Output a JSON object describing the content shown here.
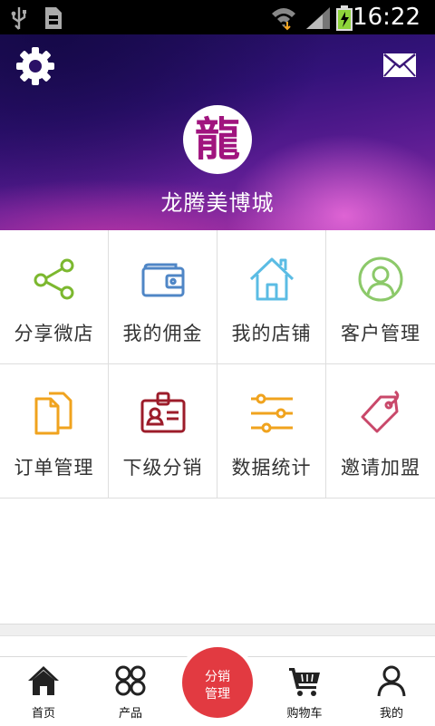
{
  "status_bar": {
    "time": "16:22",
    "icons": [
      "usb-icon",
      "sd-card-icon",
      "wifi-icon",
      "signal-icon",
      "battery-charging-icon"
    ]
  },
  "header": {
    "brand_name": "龙腾美博城",
    "logo_glyph": "龍",
    "icons": [
      "gear-icon",
      "mail-icon"
    ]
  },
  "menu": [
    {
      "label": "分享微店",
      "icon": "share-icon",
      "color": "#7cb82f"
    },
    {
      "label": "我的佣金",
      "icon": "wallet-icon",
      "color": "#4f86c6"
    },
    {
      "label": "我的店铺",
      "icon": "home-icon",
      "color": "#5bbce4"
    },
    {
      "label": "客户管理",
      "icon": "user-circle-icon",
      "color": "#8cc96a"
    },
    {
      "label": "订单管理",
      "icon": "documents-icon",
      "color": "#f0a31e"
    },
    {
      "label": "下级分销",
      "icon": "id-badge-icon",
      "color": "#9c1c2a"
    },
    {
      "label": "数据统计",
      "icon": "sliders-icon",
      "color": "#f0a31e"
    },
    {
      "label": "邀请加盟",
      "icon": "tag-icon",
      "color": "#c9486a"
    }
  ],
  "tabbar": {
    "tabs": [
      {
        "label": "首页",
        "icon": "home-icon"
      },
      {
        "label": "产品",
        "icon": "grid-icon"
      },
      {
        "label": "购物车",
        "icon": "cart-icon"
      },
      {
        "label": "我的",
        "icon": "user-icon"
      }
    ],
    "center_line1": "分销",
    "center_line2": "管理",
    "center_color": "#e23a41"
  }
}
